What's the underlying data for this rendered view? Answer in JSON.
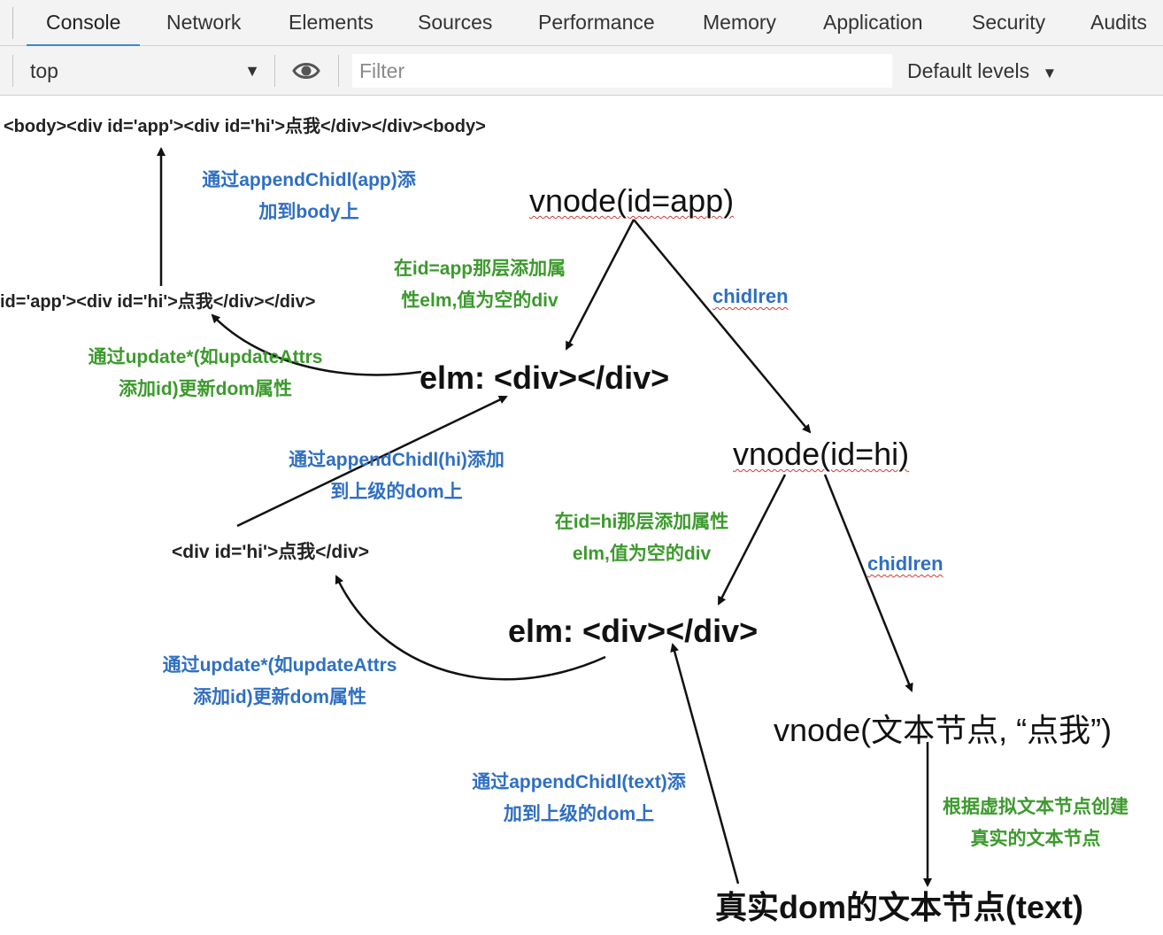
{
  "tabs": [
    {
      "label": "Console",
      "active": true
    },
    {
      "label": "Network"
    },
    {
      "label": "Elements"
    },
    {
      "label": "Sources"
    },
    {
      "label": "Performance"
    },
    {
      "label": "Memory"
    },
    {
      "label": "Application"
    },
    {
      "label": "Security"
    },
    {
      "label": "Audits"
    }
  ],
  "toolbar": {
    "context": "top",
    "filter_placeholder": "Filter",
    "levels": "Default levels"
  },
  "diagram": {
    "body_html": "<body><div id='app'><div id='hi'>点我</div></div><body>",
    "app_html": "id='app'><div id='hi'>点我</div></div>",
    "hi_html": "<div id='hi'>点我</div>",
    "vnode_app": "vnode(id=app)",
    "vnode_hi": "vnode(id=hi)",
    "vnode_text": "vnode(文本节点, “点我”)",
    "elm_app": "elm: <div></div>",
    "elm_hi": "elm: <div></div>",
    "real_text": "真实dom的文本节点(text)",
    "children_label_1": "chidlren",
    "children_label_2": "chidlren",
    "note_append_app_1": "通过appendChidl(app)添",
    "note_append_app_2": "加到body上",
    "note_elm_app_1": "在id=app那层添加属",
    "note_elm_app_2": "性elm,值为空的div",
    "note_update_app_1": "通过update*(如updateAttrs",
    "note_update_app_2": "添加id)更新dom属性",
    "note_append_hi_1": "通过appendChidl(hi)添加",
    "note_append_hi_2": "到上级的dom上",
    "note_elm_hi_1": "在id=hi那层添加属性",
    "note_elm_hi_2": "elm,值为空的div",
    "note_update_hi_1": "通过update*(如updateAttrs",
    "note_update_hi_2": "添加id)更新dom属性",
    "note_append_text_1": "通过appendChidl(text)添",
    "note_append_text_2": "加到上级的dom上",
    "note_create_text_1": "根据虚拟文本节点创建",
    "note_create_text_2": "真实的文本节点"
  },
  "colors": {
    "accent": "#3c86d8",
    "note_blue": "#2f6fc2",
    "note_green": "#3c9a2d",
    "squiggle": "#d23a3a"
  }
}
